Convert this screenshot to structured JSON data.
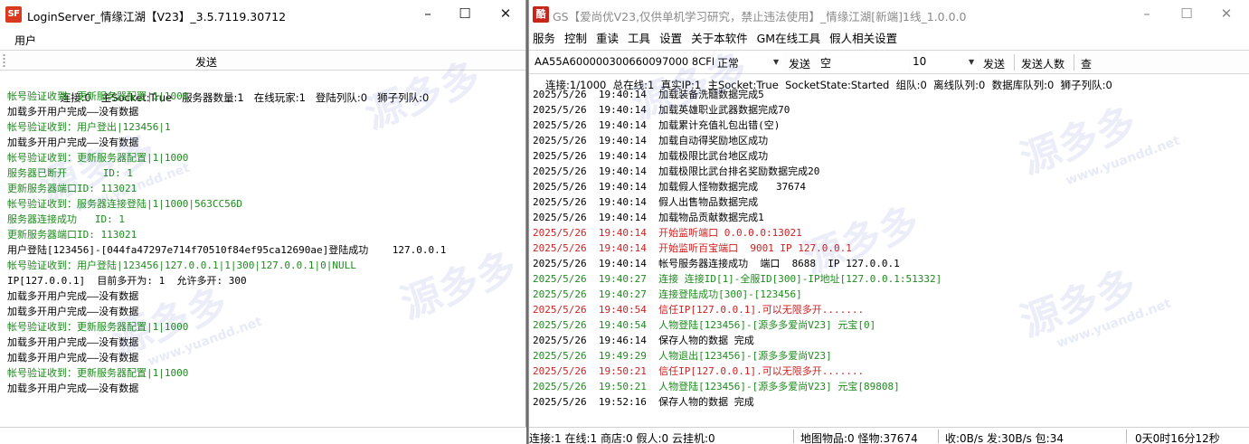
{
  "colors": {
    "green": "#1e8a1e",
    "red": "#d02020",
    "black": "#000000"
  },
  "watermark": {
    "brand": "源多多",
    "site": "www.yuandd.net"
  },
  "login_window": {
    "title": "LoginServer_情缘江湖【V23】_3.5.7119.30712",
    "icon": "SF",
    "menu": [
      "用户"
    ],
    "send_label": "发送",
    "status": {
      "connect": "连接:0",
      "main_socket": "主Socket:True",
      "server_count": "服务器数量:1",
      "online": "在线玩家:1",
      "login_queue": "登陆列队:0",
      "lion_queue": "狮子列队:0"
    },
    "log": [
      {
        "text": "帐号验证收到：更新服务器配置|1|1000",
        "color": "green"
      },
      {
        "text": "加载多开用户完成——没有数据",
        "color": "black"
      },
      {
        "text": "帐号验证收到：用户登出|123456|1",
        "color": "green"
      },
      {
        "text": "加载多开用户完成——没有数据",
        "color": "black"
      },
      {
        "text": "帐号验证收到：更新服务器配置|1|1000",
        "color": "green"
      },
      {
        "text": "服务器已断开      ID: 1",
        "color": "green"
      },
      {
        "text": "更新服务器端口ID: 113021",
        "color": "green"
      },
      {
        "text": "帐号验证收到：服务器连接登陆|1|1000|563CC56D",
        "color": "green"
      },
      {
        "text": "服务器连接成功   ID: 1",
        "color": "green"
      },
      {
        "text": "更新服务器端口ID: 113021",
        "color": "green"
      },
      {
        "text": "用户登陆[123456]-[044fa47297e714f70510f84ef95ca12690ae]登陆成功    127.0.0.1",
        "color": "black"
      },
      {
        "text": "帐号验证收到：用户登陆|123456|127.0.0.1|1|300|127.0.0.1|0|NULL",
        "color": "green"
      },
      {
        "text": "IP[127.0.0.1]  目前多开为: 1  允许多开: 300",
        "color": "black"
      },
      {
        "text": "加载多开用户完成——没有数据",
        "color": "black"
      },
      {
        "text": "加载多开用户完成——没有数据",
        "color": "black"
      },
      {
        "text": "帐号验证收到：更新服务器配置|1|1000",
        "color": "green"
      },
      {
        "text": "加载多开用户完成——没有数据",
        "color": "black"
      },
      {
        "text": "加载多开用户完成——没有数据",
        "color": "black"
      },
      {
        "text": "帐号验证收到：更新服务器配置|1|1000",
        "color": "green"
      },
      {
        "text": "加载多开用户完成——没有数据",
        "color": "black"
      }
    ]
  },
  "gs_window": {
    "title": "GS【爱尚优V23,仅供单机学习研究，禁止违法使用】_情缘江湖[新端]1线_1.0.0.0",
    "icon": "酷",
    "menu": [
      "服务",
      "控制",
      "重读",
      "工具",
      "设置",
      "关于本软件",
      "GM在线工具",
      "假人相关设置"
    ],
    "toolbar": {
      "id_value": "AA55A600000300660097000 8CFB",
      "mode_value": "正常",
      "send_label": "发送",
      "message_value": "空",
      "count_value": "10",
      "send2_label": "发送",
      "send_count_label": "发送人数",
      "query_label": "查"
    },
    "status": "连接:1/1000  总在线:1  真实IP:1  主Socket:True  SocketState:Started  组队:0  离线队列:0  数据库队列:0  狮子列队:0",
    "log": [
      {
        "text": "2025/5/26  19:40:14  加载装备洗髓数据完成5",
        "color": "black"
      },
      {
        "text": "2025/5/26  19:40:14  加载英雄职业武器数据完成70",
        "color": "black"
      },
      {
        "text": "2025/5/26  19:40:14  加载累计充值礼包出错(空)",
        "color": "black"
      },
      {
        "text": "2025/5/26  19:40:14  加载自动得奖励地区成功",
        "color": "black"
      },
      {
        "text": "2025/5/26  19:40:14  加载极限比武台地区成功",
        "color": "black"
      },
      {
        "text": "2025/5/26  19:40:14  加载极限比武台排名奖励数据完成20",
        "color": "black"
      },
      {
        "text": "2025/5/26  19:40:14  加载假人怪物数据完成   37674",
        "color": "black"
      },
      {
        "text": "2025/5/26  19:40:14  假人出售物品数据完成",
        "color": "black"
      },
      {
        "text": "2025/5/26  19:40:14  加载物品贡献数据完成1",
        "color": "black"
      },
      {
        "text": "2025/5/26  19:40:14  开始监听端口 0.0.0.0:13021",
        "color": "red"
      },
      {
        "text": "2025/5/26  19:40:14  开始监听百宝端口  9001 IP 127.0.0.1",
        "color": "red"
      },
      {
        "text": "2025/5/26  19:40:14  帐号服务器连接成功  端口  8688  IP 127.0.0.1",
        "color": "black"
      },
      {
        "text": "2025/5/26  19:40:27  连接 连接ID[1]-全服ID[300]-IP地址[127.0.0.1:51332]",
        "color": "green"
      },
      {
        "text": "2025/5/26  19:40:27  连接登陆成功[300]-[123456]",
        "color": "green"
      },
      {
        "text": "2025/5/26  19:40:54  信任IP[127.0.0.1].可以无限多开.......",
        "color": "red"
      },
      {
        "text": "2025/5/26  19:40:54  人物登陆[123456]-[源多多爱尚V23] 元宝[0]",
        "color": "green"
      },
      {
        "text": "2025/5/26  19:46:14  保存人物的数据 完成",
        "color": "black"
      },
      {
        "text": "2025/5/26  19:49:29  人物退出[123456]-[源多多爱尚V23]",
        "color": "green"
      },
      {
        "text": "2025/5/26  19:50:21  信任IP[127.0.0.1].可以无限多开.......",
        "color": "red"
      },
      {
        "text": "2025/5/26  19:50:21  人物登陆[123456]-[源多多爱尚V23] 元宝[89808]",
        "color": "green"
      },
      {
        "text": "2025/5/26  19:52:16  保存人物的数据 完成",
        "color": "black"
      }
    ],
    "statusbar": {
      "left": "连接:1 在线:1 商店:0 假人:0 云挂机:0",
      "items": "地图物品:0 怪物:37674",
      "traffic": "收:0B/s 发:30B/s 包:34",
      "uptime": "0天0时16分12秒"
    }
  }
}
